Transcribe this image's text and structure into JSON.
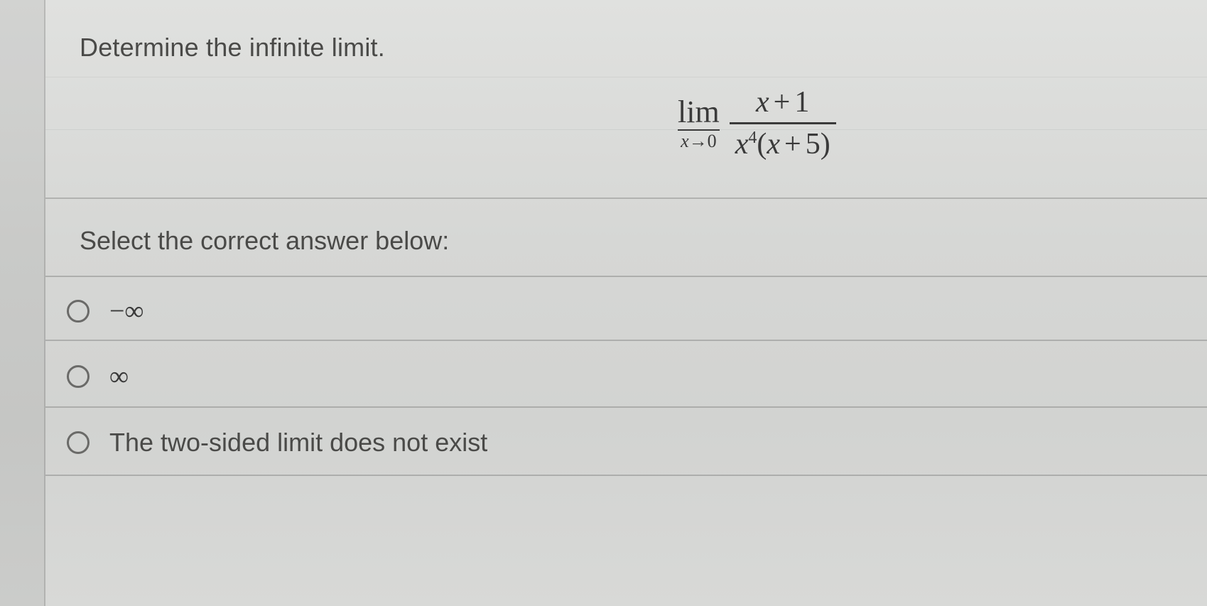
{
  "question": {
    "prompt": "Determine the infinite limit.",
    "limit": {
      "operator": "lim",
      "approach_var": "x",
      "approach_arrow": "→",
      "approach_value": "0",
      "numerator_var": "x",
      "numerator_op": "+",
      "numerator_const": "1",
      "denominator_var": "x",
      "denominator_exp": "4",
      "denominator_paren_open": "(",
      "denominator_inner_var": "x",
      "denominator_inner_op": "+",
      "denominator_inner_const": "5",
      "denominator_paren_close": ")"
    }
  },
  "instructions": "Select the correct answer below:",
  "options": [
    {
      "label": "−∞"
    },
    {
      "label": "∞"
    },
    {
      "label": "The two-sided limit does not exist"
    }
  ]
}
